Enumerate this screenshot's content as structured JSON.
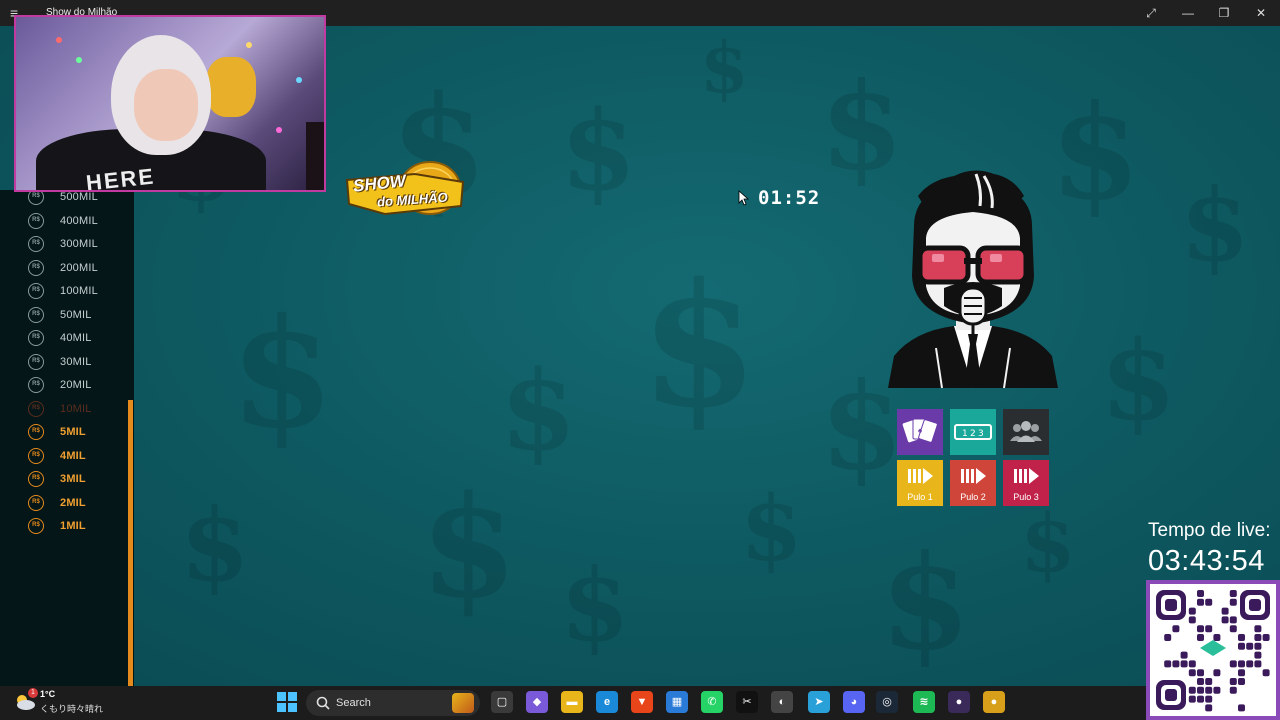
{
  "window": {
    "title": "Show do Milhão",
    "menu_icon": "hamburger-icon",
    "controls": [
      "expand-icon",
      "minimize-icon",
      "maximize-icon",
      "close-icon"
    ]
  },
  "logo": {
    "line1": "SHOW",
    "line2": "do MILHÃO"
  },
  "timer": {
    "value": "01:52"
  },
  "ladder": {
    "currency": "R$",
    "items": [
      {
        "amount": "500MIL",
        "state": "normal"
      },
      {
        "amount": "400MIL",
        "state": "normal"
      },
      {
        "amount": "300MIL",
        "state": "normal"
      },
      {
        "amount": "200MIL",
        "state": "normal"
      },
      {
        "amount": "100MIL",
        "state": "normal"
      },
      {
        "amount": "50MIL",
        "state": "normal"
      },
      {
        "amount": "40MIL",
        "state": "normal"
      },
      {
        "amount": "30MIL",
        "state": "normal"
      },
      {
        "amount": "20MIL",
        "state": "normal"
      },
      {
        "amount": "10MIL",
        "state": "dim"
      },
      {
        "amount": "5MIL",
        "state": "safe"
      },
      {
        "amount": "4MIL",
        "state": "safe"
      },
      {
        "amount": "3MIL",
        "state": "safe"
      },
      {
        "amount": "2MIL",
        "state": "safe"
      },
      {
        "amount": "1MIL",
        "state": "safe"
      }
    ]
  },
  "webcam": {
    "shirt_text": "HERE"
  },
  "lifelines": [
    {
      "name": "cards",
      "icon": "cards-icon",
      "color": "#6a3aa8",
      "label": ""
    },
    {
      "name": "placards",
      "icon": "placards-icon",
      "color": "#1aa89a",
      "label": ""
    },
    {
      "name": "audience",
      "icon": "audience-icon",
      "color": "#2a2e30",
      "label": ""
    },
    {
      "name": "pulo1",
      "icon": "skip-icon",
      "color": "#e8b51a",
      "label": "Pulo 1"
    },
    {
      "name": "pulo2",
      "icon": "skip-icon",
      "color": "#d0453a",
      "label": "Pulo 2"
    },
    {
      "name": "pulo3",
      "icon": "skip-icon",
      "color": "#c0224a",
      "label": "Pulo 3"
    }
  ],
  "live": {
    "label": "Tempo de live:",
    "time": "03:43:54"
  },
  "taskbar": {
    "weather": {
      "temp": "1°C",
      "desc": "くもり時々晴れ",
      "badge": "1"
    },
    "search_label": "Search",
    "apps": [
      {
        "name": "task-view-icon",
        "color": "#3a3a3a",
        "glyph": "▢"
      },
      {
        "name": "copilot-icon",
        "color": "#7a5ad8",
        "glyph": "◆"
      },
      {
        "name": "file-explorer-icon",
        "color": "#e8b51a",
        "glyph": "▬"
      },
      {
        "name": "edge-icon",
        "color": "#1a8ad8",
        "glyph": "e"
      },
      {
        "name": "brave-icon",
        "color": "#e8461a",
        "glyph": "▼"
      },
      {
        "name": "store-icon",
        "color": "#2a7ad8",
        "glyph": "▦"
      },
      {
        "name": "whatsapp-icon",
        "color": "#25d366",
        "glyph": "✆"
      },
      {
        "name": "capcut-icon",
        "color": "#111111",
        "glyph": "✂"
      },
      {
        "name": "app-icon",
        "color": "#444444",
        "glyph": "◐"
      },
      {
        "name": "telegram-icon",
        "color": "#2aa0d8",
        "glyph": "➤"
      },
      {
        "name": "discord-icon",
        "color": "#5865f2",
        "glyph": "◕"
      },
      {
        "name": "steam-icon",
        "color": "#1b2838",
        "glyph": "◎"
      },
      {
        "name": "spotify-icon",
        "color": "#1db954",
        "glyph": "≋"
      },
      {
        "name": "obs-icon",
        "color": "#3a2a5a",
        "glyph": "●"
      },
      {
        "name": "active-app-icon",
        "color": "#d8a01a",
        "glyph": "●"
      }
    ]
  }
}
